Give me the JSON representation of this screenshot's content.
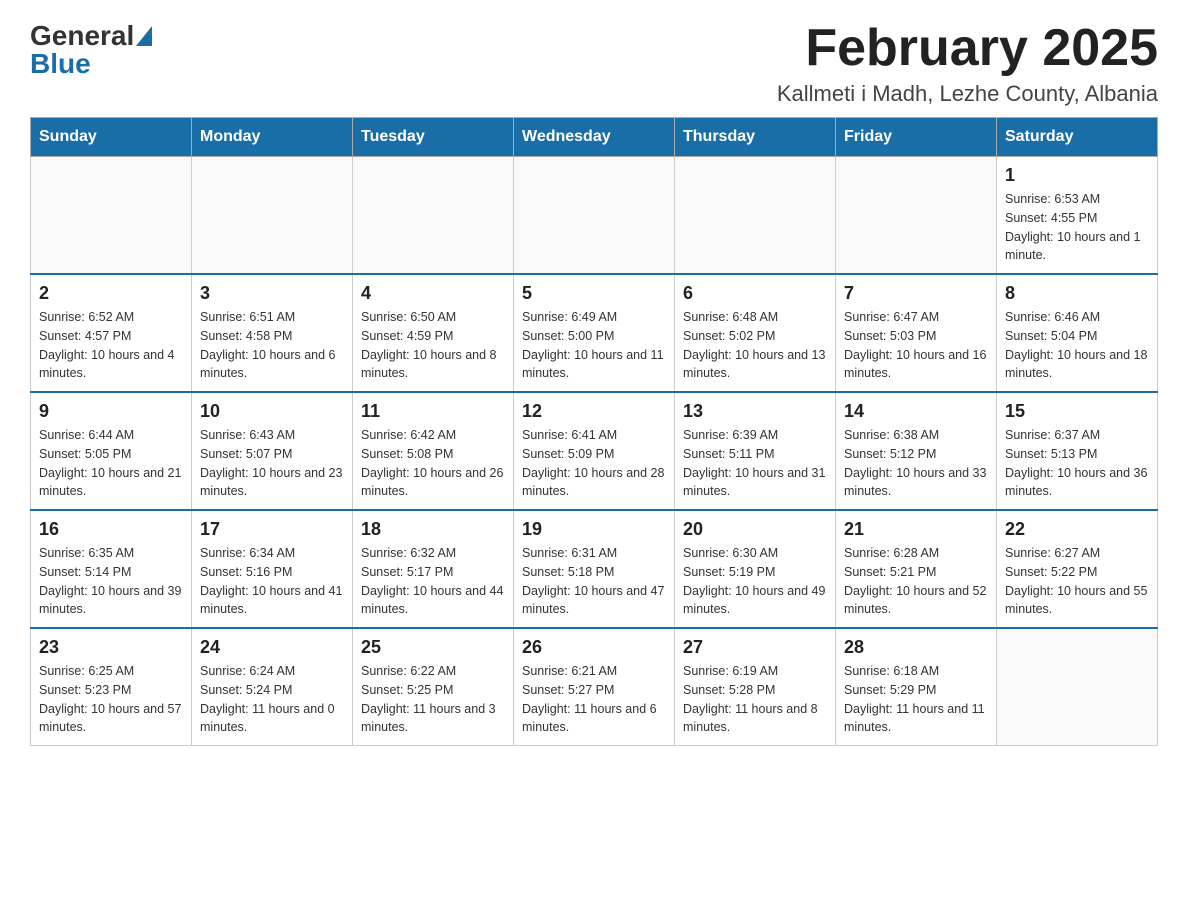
{
  "header": {
    "logo_general": "General",
    "logo_blue": "Blue",
    "month_title": "February 2025",
    "location": "Kallmeti i Madh, Lezhe County, Albania"
  },
  "days_of_week": [
    "Sunday",
    "Monday",
    "Tuesday",
    "Wednesday",
    "Thursday",
    "Friday",
    "Saturday"
  ],
  "weeks": [
    [
      {
        "day": "",
        "info": ""
      },
      {
        "day": "",
        "info": ""
      },
      {
        "day": "",
        "info": ""
      },
      {
        "day": "",
        "info": ""
      },
      {
        "day": "",
        "info": ""
      },
      {
        "day": "",
        "info": ""
      },
      {
        "day": "1",
        "info": "Sunrise: 6:53 AM\nSunset: 4:55 PM\nDaylight: 10 hours and 1 minute."
      }
    ],
    [
      {
        "day": "2",
        "info": "Sunrise: 6:52 AM\nSunset: 4:57 PM\nDaylight: 10 hours and 4 minutes."
      },
      {
        "day": "3",
        "info": "Sunrise: 6:51 AM\nSunset: 4:58 PM\nDaylight: 10 hours and 6 minutes."
      },
      {
        "day": "4",
        "info": "Sunrise: 6:50 AM\nSunset: 4:59 PM\nDaylight: 10 hours and 8 minutes."
      },
      {
        "day": "5",
        "info": "Sunrise: 6:49 AM\nSunset: 5:00 PM\nDaylight: 10 hours and 11 minutes."
      },
      {
        "day": "6",
        "info": "Sunrise: 6:48 AM\nSunset: 5:02 PM\nDaylight: 10 hours and 13 minutes."
      },
      {
        "day": "7",
        "info": "Sunrise: 6:47 AM\nSunset: 5:03 PM\nDaylight: 10 hours and 16 minutes."
      },
      {
        "day": "8",
        "info": "Sunrise: 6:46 AM\nSunset: 5:04 PM\nDaylight: 10 hours and 18 minutes."
      }
    ],
    [
      {
        "day": "9",
        "info": "Sunrise: 6:44 AM\nSunset: 5:05 PM\nDaylight: 10 hours and 21 minutes."
      },
      {
        "day": "10",
        "info": "Sunrise: 6:43 AM\nSunset: 5:07 PM\nDaylight: 10 hours and 23 minutes."
      },
      {
        "day": "11",
        "info": "Sunrise: 6:42 AM\nSunset: 5:08 PM\nDaylight: 10 hours and 26 minutes."
      },
      {
        "day": "12",
        "info": "Sunrise: 6:41 AM\nSunset: 5:09 PM\nDaylight: 10 hours and 28 minutes."
      },
      {
        "day": "13",
        "info": "Sunrise: 6:39 AM\nSunset: 5:11 PM\nDaylight: 10 hours and 31 minutes."
      },
      {
        "day": "14",
        "info": "Sunrise: 6:38 AM\nSunset: 5:12 PM\nDaylight: 10 hours and 33 minutes."
      },
      {
        "day": "15",
        "info": "Sunrise: 6:37 AM\nSunset: 5:13 PM\nDaylight: 10 hours and 36 minutes."
      }
    ],
    [
      {
        "day": "16",
        "info": "Sunrise: 6:35 AM\nSunset: 5:14 PM\nDaylight: 10 hours and 39 minutes."
      },
      {
        "day": "17",
        "info": "Sunrise: 6:34 AM\nSunset: 5:16 PM\nDaylight: 10 hours and 41 minutes."
      },
      {
        "day": "18",
        "info": "Sunrise: 6:32 AM\nSunset: 5:17 PM\nDaylight: 10 hours and 44 minutes."
      },
      {
        "day": "19",
        "info": "Sunrise: 6:31 AM\nSunset: 5:18 PM\nDaylight: 10 hours and 47 minutes."
      },
      {
        "day": "20",
        "info": "Sunrise: 6:30 AM\nSunset: 5:19 PM\nDaylight: 10 hours and 49 minutes."
      },
      {
        "day": "21",
        "info": "Sunrise: 6:28 AM\nSunset: 5:21 PM\nDaylight: 10 hours and 52 minutes."
      },
      {
        "day": "22",
        "info": "Sunrise: 6:27 AM\nSunset: 5:22 PM\nDaylight: 10 hours and 55 minutes."
      }
    ],
    [
      {
        "day": "23",
        "info": "Sunrise: 6:25 AM\nSunset: 5:23 PM\nDaylight: 10 hours and 57 minutes."
      },
      {
        "day": "24",
        "info": "Sunrise: 6:24 AM\nSunset: 5:24 PM\nDaylight: 11 hours and 0 minutes."
      },
      {
        "day": "25",
        "info": "Sunrise: 6:22 AM\nSunset: 5:25 PM\nDaylight: 11 hours and 3 minutes."
      },
      {
        "day": "26",
        "info": "Sunrise: 6:21 AM\nSunset: 5:27 PM\nDaylight: 11 hours and 6 minutes."
      },
      {
        "day": "27",
        "info": "Sunrise: 6:19 AM\nSunset: 5:28 PM\nDaylight: 11 hours and 8 minutes."
      },
      {
        "day": "28",
        "info": "Sunrise: 6:18 AM\nSunset: 5:29 PM\nDaylight: 11 hours and 11 minutes."
      },
      {
        "day": "",
        "info": ""
      }
    ]
  ]
}
